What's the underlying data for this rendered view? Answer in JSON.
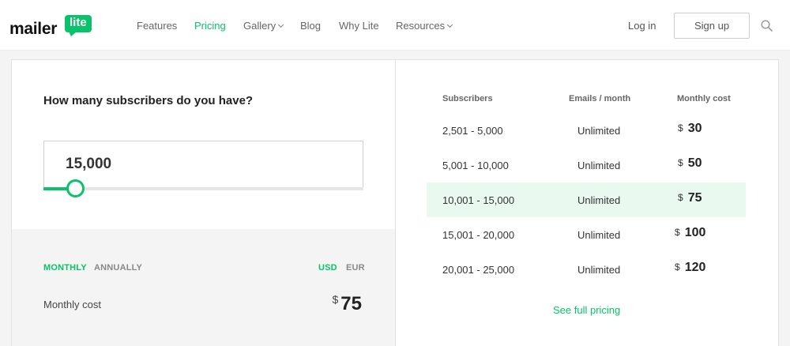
{
  "header": {
    "logo_text": "mailer",
    "logo_badge": "lite",
    "nav": [
      {
        "label": "Features",
        "active": false,
        "dropdown": false
      },
      {
        "label": "Pricing",
        "active": true,
        "dropdown": false
      },
      {
        "label": "Gallery",
        "active": false,
        "dropdown": true
      },
      {
        "label": "Blog",
        "active": false,
        "dropdown": false
      },
      {
        "label": "Why Lite",
        "active": false,
        "dropdown": false
      },
      {
        "label": "Resources",
        "active": false,
        "dropdown": true
      }
    ],
    "login": "Log in",
    "signup": "Sign up",
    "search_icon": "search-icon"
  },
  "calculator": {
    "question": "How many subscribers do you have?",
    "subscribers_value": "15,000",
    "slider_fraction": 0.1,
    "billing": {
      "monthly": "MONTHLY",
      "annually": "ANNUALLY",
      "selected": "monthly"
    },
    "currency": {
      "usd": "USD",
      "eur": "EUR",
      "selected": "usd"
    },
    "cost_label": "Monthly cost",
    "cost_currency": "$",
    "cost_value": "75"
  },
  "pricing_table": {
    "headers": {
      "subscribers": "Subscribers",
      "emails": "Emails / month",
      "cost": "Monthly cost"
    },
    "rows": [
      {
        "range": "2,501  -  5,000",
        "emails": "Unlimited",
        "currency": "$",
        "cost": "30",
        "highlight": false
      },
      {
        "range": "5,001  -  10,000",
        "emails": "Unlimited",
        "currency": "$",
        "cost": "50",
        "highlight": false
      },
      {
        "range": "10,001  -  15,000",
        "emails": "Unlimited",
        "currency": "$",
        "cost": "75",
        "highlight": true
      },
      {
        "range": "15,001  -  20,000",
        "emails": "Unlimited",
        "currency": "$",
        "cost": "100",
        "highlight": false
      },
      {
        "range": "20,001  -  25,000",
        "emails": "Unlimited",
        "currency": "$",
        "cost": "120",
        "highlight": false
      }
    ],
    "full_pricing_link": "See full pricing"
  },
  "colors": {
    "brand_green": "#09c269",
    "highlight_row": "#e9f9f0"
  }
}
